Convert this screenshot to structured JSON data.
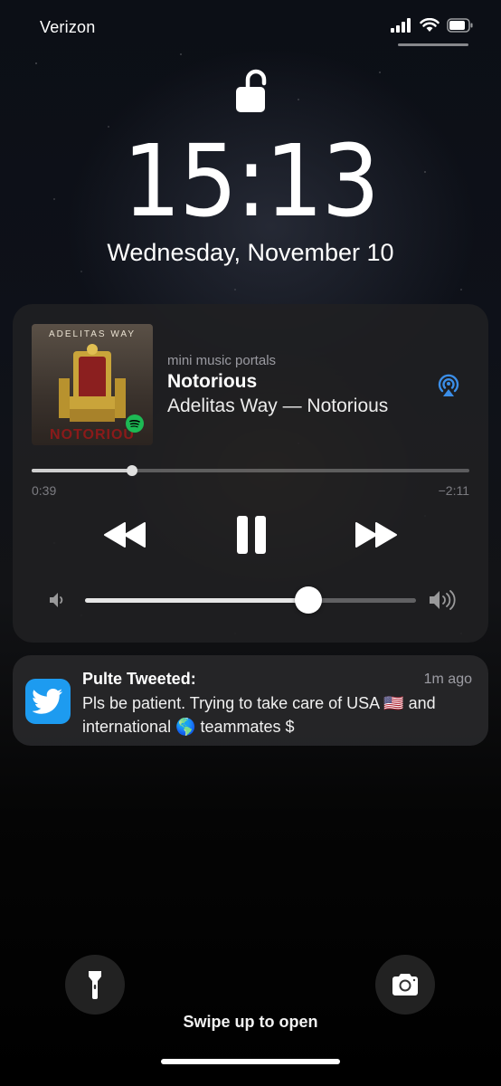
{
  "status_bar": {
    "carrier": "Verizon",
    "icons": [
      "cellular-signal-icon",
      "wifi-icon",
      "battery-icon"
    ]
  },
  "lock_screen": {
    "lock_state": "unlocked",
    "time": "15:13",
    "date": "Wednesday, November 10"
  },
  "now_playing": {
    "album_art_band": "ADELITAS WAY",
    "album_art_title": "NOTORIOU",
    "source": "mini music portals",
    "title": "Notorious",
    "subtitle": "Adelitas Way — Notorious",
    "elapsed": "0:39",
    "remaining": "−2:11",
    "progress_fraction": 0.23,
    "volume_fraction": 0.675,
    "controls": [
      "rewind-icon",
      "pause-icon",
      "fast-forward-icon"
    ],
    "accent_color": "#3b8ee8"
  },
  "notification": {
    "app_icon": "twitter-bird-icon",
    "title": "Pulte Tweeted:",
    "time": "1m ago",
    "body": "Pls be patient. Trying to take care of USA 🇺🇸 and international 🌎 teammates $"
  },
  "bottom": {
    "flashlight_icon": "flashlight-icon",
    "camera_icon": "camera-icon",
    "swipe_hint": "Swipe up to open"
  }
}
